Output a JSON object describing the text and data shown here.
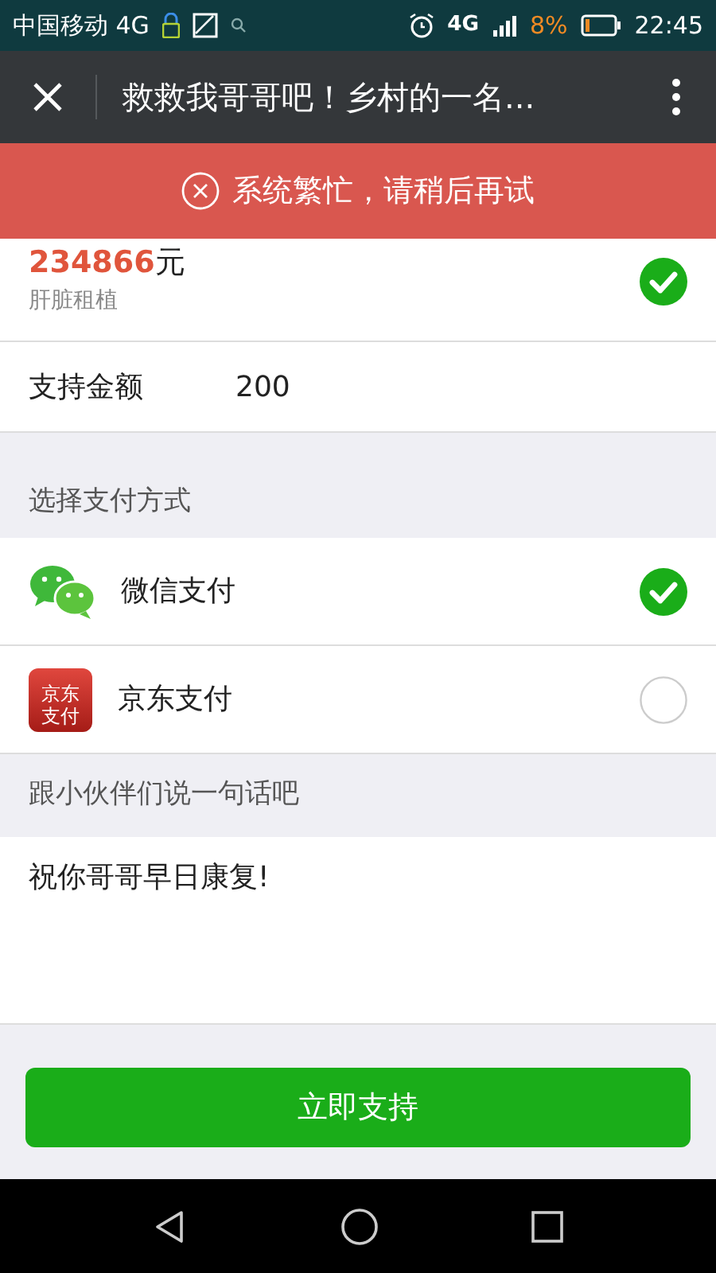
{
  "status_bar": {
    "carrier": "中国移动 4G",
    "network": "4G",
    "battery": "8%",
    "time": "22:45"
  },
  "header": {
    "title": "救救我哥哥吧！乡村的一名..."
  },
  "toast": {
    "message": "系统繁忙，请稍后再试"
  },
  "project": {
    "amount": "234866",
    "unit": "元",
    "description": "肝脏租植",
    "selected": true
  },
  "support": {
    "label": "支持金额",
    "value": "200"
  },
  "payment_heading": "选择支付方式",
  "payments": [
    {
      "kind": "wechat",
      "name": "微信支付",
      "selected": true
    },
    {
      "kind": "jd",
      "name": "京东支付",
      "logo_lines": [
        "京东",
        "支付"
      ],
      "selected": false
    }
  ],
  "message_heading": "跟小伙伴们说一句话吧",
  "message": {
    "value": "祝你哥哥早日康复!"
  },
  "submit": "立即支持"
}
